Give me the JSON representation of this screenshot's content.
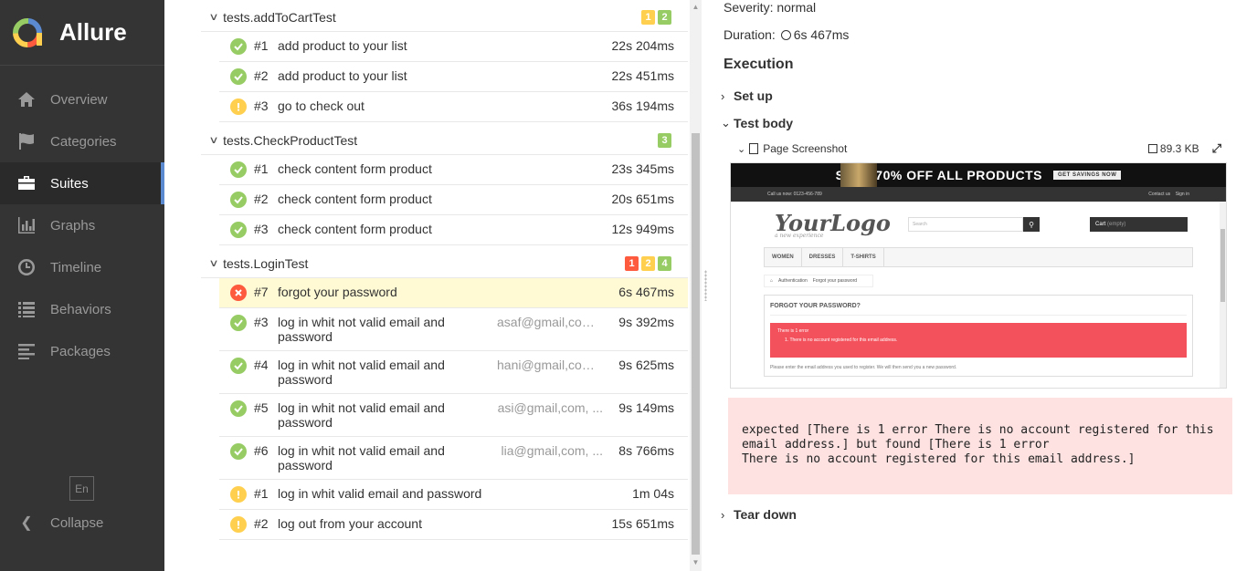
{
  "app": {
    "name": "Allure",
    "nav": [
      {
        "label": "Overview",
        "icon": "home-icon"
      },
      {
        "label": "Categories",
        "icon": "flag-icon"
      },
      {
        "label": "Suites",
        "icon": "briefcase-icon",
        "active": true
      },
      {
        "label": "Graphs",
        "icon": "bar-chart-icon"
      },
      {
        "label": "Timeline",
        "icon": "clock-icon"
      },
      {
        "label": "Behaviors",
        "icon": "list-icon"
      },
      {
        "label": "Packages",
        "icon": "align-left-icon"
      }
    ],
    "language": "En",
    "collapse_label": "Collapse"
  },
  "suites": [
    {
      "title": "tests.addToCartTest",
      "counts": [
        {
          "value": "1",
          "status": "broken"
        },
        {
          "value": "2",
          "status": "passed"
        }
      ],
      "tests": [
        {
          "order": "#1",
          "name": "add product to your list",
          "param": "",
          "duration": "22s 204ms",
          "status": "passed"
        },
        {
          "order": "#2",
          "name": "add product to your list",
          "param": "",
          "duration": "22s 451ms",
          "status": "passed"
        },
        {
          "order": "#3",
          "name": "go to check out",
          "param": "",
          "duration": "36s 194ms",
          "status": "broken"
        }
      ]
    },
    {
      "title": "tests.CheckProductTest",
      "counts": [
        {
          "value": "3",
          "status": "passed"
        }
      ],
      "tests": [
        {
          "order": "#1",
          "name": "check content form product",
          "param": "",
          "duration": "23s 345ms",
          "status": "passed"
        },
        {
          "order": "#2",
          "name": "check content form product",
          "param": "",
          "duration": "20s 651ms",
          "status": "passed"
        },
        {
          "order": "#3",
          "name": "check content form product",
          "param": "",
          "duration": "12s 949ms",
          "status": "passed"
        }
      ]
    },
    {
      "title": "tests.LoginTest",
      "counts": [
        {
          "value": "1",
          "status": "failed"
        },
        {
          "value": "2",
          "status": "broken"
        },
        {
          "value": "4",
          "status": "passed"
        }
      ],
      "tests": [
        {
          "order": "#7",
          "name": "forgot your password",
          "param": "",
          "duration": "6s 467ms",
          "status": "failed",
          "selected": true
        },
        {
          "order": "#3",
          "name": "log in whit not valid email and password",
          "param": "asaf@gmail,com,...",
          "duration": "9s 392ms",
          "status": "passed"
        },
        {
          "order": "#4",
          "name": "log in whit not valid email and password",
          "param": "hani@gmail,com,...",
          "duration": "9s 625ms",
          "status": "passed"
        },
        {
          "order": "#5",
          "name": "log in whit not valid email and password",
          "param": "asi@gmail,com, ...",
          "duration": "9s 149ms",
          "status": "passed"
        },
        {
          "order": "#6",
          "name": "log in whit not valid email and password",
          "param": "lia@gmail,com, ...",
          "duration": "8s 766ms",
          "status": "passed"
        },
        {
          "order": "#1",
          "name": "log in whit valid email and password",
          "param": "",
          "duration": "1m 04s",
          "status": "broken"
        },
        {
          "order": "#2",
          "name": "log out from your account",
          "param": "",
          "duration": "15s 651ms",
          "status": "broken"
        }
      ]
    }
  ],
  "detail": {
    "severity_label": "Severity:",
    "severity_value": "normal",
    "duration_label": "Duration:",
    "duration_value": "6s 467ms",
    "execution_heading": "Execution",
    "setup_label": "Set up",
    "test_body_label": "Test body",
    "attachment": {
      "title": "Page Screenshot",
      "size": "89.3 KB"
    },
    "screenshot": {
      "banner": "SALE 70% OFF ALL PRODUCTS",
      "banner_button": "GET SAVINGS NOW",
      "phone": "Call us now: 0123-456-789",
      "contact": "Contact us",
      "sign_in": "Sign in",
      "logo": "YourLogo",
      "logo_tagline": "a new experience",
      "search_placeholder": "Search",
      "cart": "Cart",
      "cart_empty": "(empty)",
      "menu": [
        "WOMEN",
        "DRESSES",
        "T-SHIRTS"
      ],
      "crumb_1": "Authentication",
      "crumb_2": "Forgot your password",
      "box_title": "FORGOT YOUR PASSWORD?",
      "alert_title": "There is 1 error",
      "alert_item": "1.   There is no account registered for this email address.",
      "note": "Please enter the email address you used to register. We will then send you a new password."
    },
    "error_message": "expected [There is 1 error There is no account registered for this email address.] but found [There is 1 error\nThere is no account registered for this email address.]",
    "teardown_label": "Tear down"
  }
}
